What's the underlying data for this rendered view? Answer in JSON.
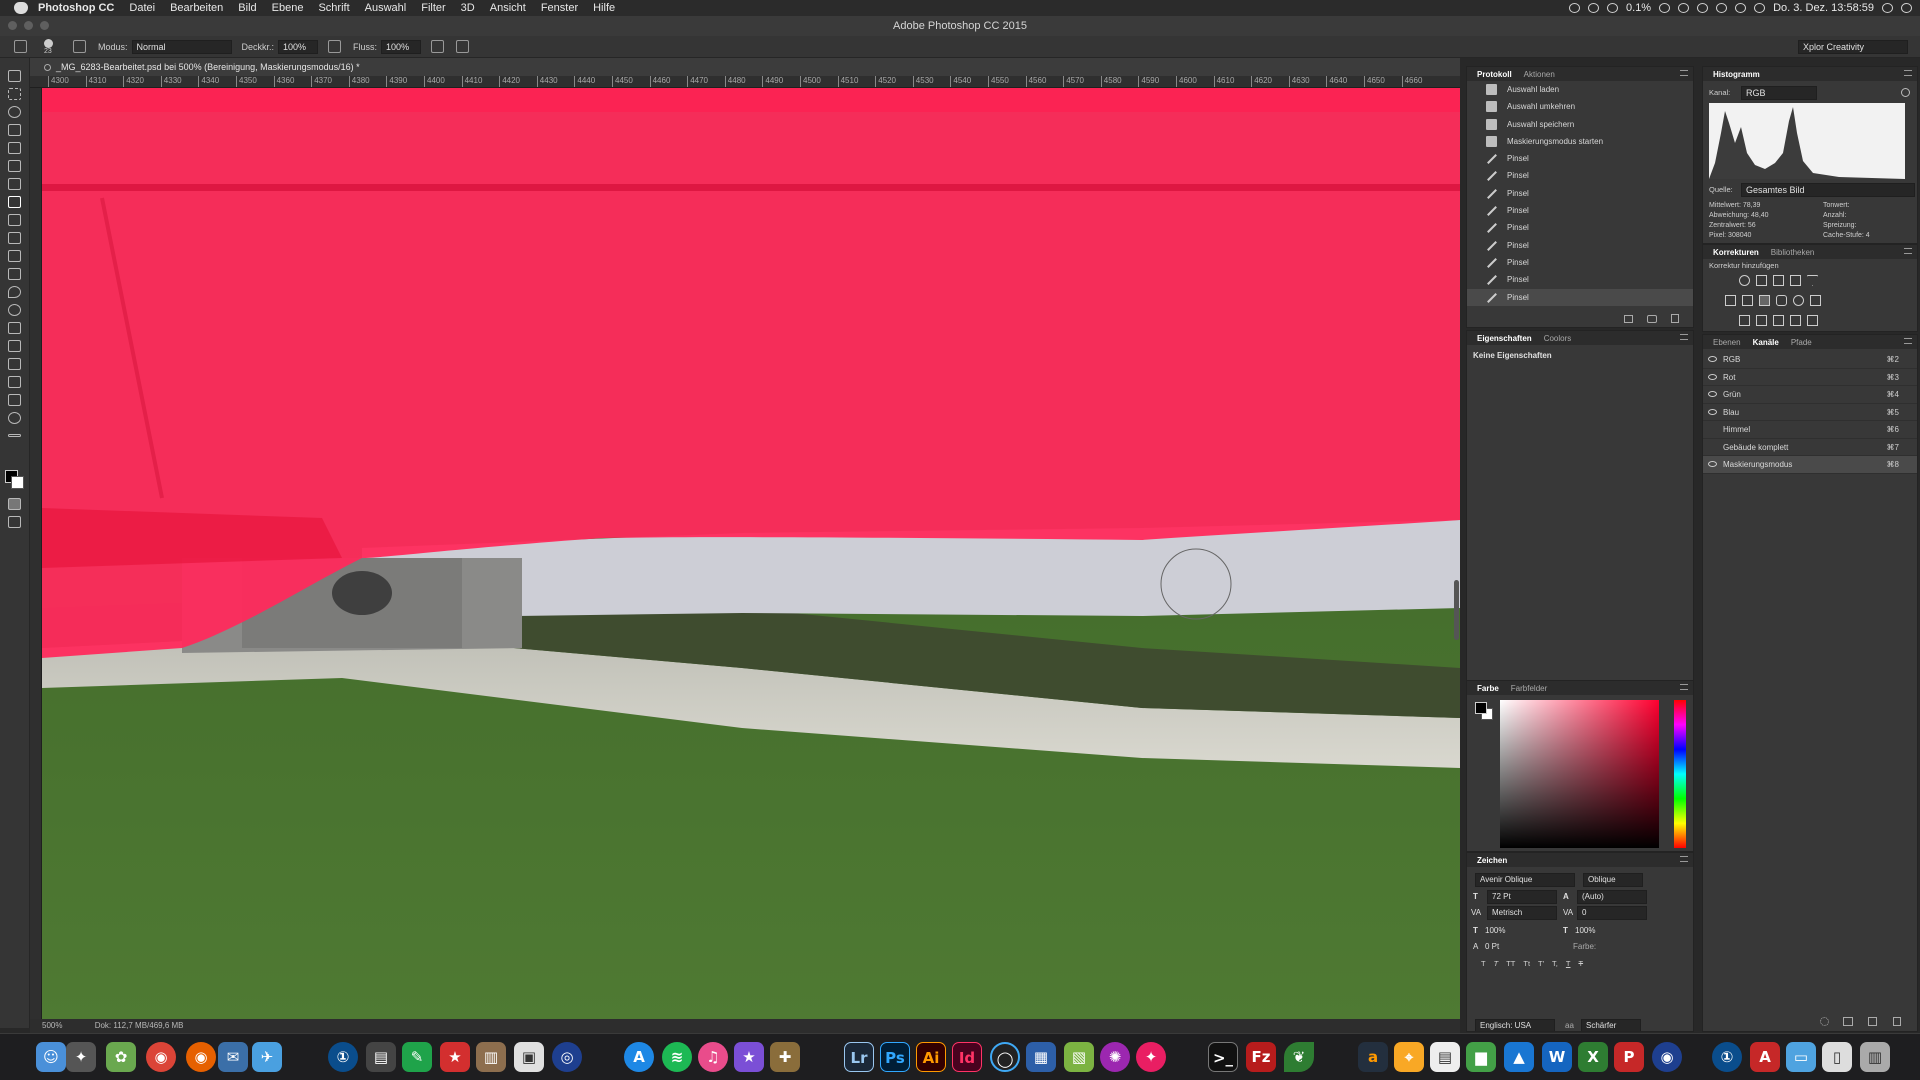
{
  "menubar": {
    "app": "Photoshop CC",
    "items": [
      "Datei",
      "Bearbeiten",
      "Bild",
      "Ebene",
      "Schrift",
      "Auswahl",
      "Filter",
      "3D",
      "Ansicht",
      "Fenster",
      "Hilfe"
    ],
    "battery": "0.1%",
    "datetime": "Do. 3. Dez.  13:58:59"
  },
  "window": {
    "title": "Adobe Photoshop CC 2015"
  },
  "options": {
    "size": "23",
    "mode_label": "Modus:",
    "mode_value": "Normal",
    "opacity_label": "Deckkr.:",
    "opacity_value": "100%",
    "flow_label": "Fluss:",
    "flow_value": "100%",
    "workspace": "Xplor Creativity"
  },
  "document": {
    "tab": "_MG_6283-Bearbeitet.psd bei 500% (Bereinigung, Maskierungsmodus/16) *",
    "ruler_labels": [
      "4300",
      "4310",
      "4320",
      "4330",
      "4340",
      "4350",
      "4360",
      "4370",
      "4380",
      "4390",
      "4400",
      "4410",
      "4420",
      "4430",
      "4440",
      "4450",
      "4460",
      "4470",
      "4480",
      "4490",
      "4500",
      "4510",
      "4520",
      "4530",
      "4540",
      "4550",
      "4560",
      "4570",
      "4580",
      "4590",
      "4600",
      "4610",
      "4620",
      "4630",
      "4640",
      "4650",
      "4660"
    ],
    "zoom": "500%",
    "doc_info": "Dok: 112,7 MB/469,6 MB"
  },
  "history": {
    "tabs": [
      "Protokoll",
      "Aktionen"
    ],
    "items": [
      {
        "label": "Auswahl laden",
        "icon": "document-icon"
      },
      {
        "label": "Auswahl umkehren",
        "icon": "document-icon"
      },
      {
        "label": "Auswahl speichern",
        "icon": "document-icon"
      },
      {
        "label": "Maskierungsmodus starten",
        "icon": "document-icon"
      },
      {
        "label": "Pinsel",
        "icon": "brush-icon"
      },
      {
        "label": "Pinsel",
        "icon": "brush-icon"
      },
      {
        "label": "Pinsel",
        "icon": "brush-icon"
      },
      {
        "label": "Pinsel",
        "icon": "brush-icon"
      },
      {
        "label": "Pinsel",
        "icon": "brush-icon"
      },
      {
        "label": "Pinsel",
        "icon": "brush-icon"
      },
      {
        "label": "Pinsel",
        "icon": "brush-icon"
      },
      {
        "label": "Pinsel",
        "icon": "brush-icon"
      },
      {
        "label": "Pinsel",
        "icon": "brush-icon"
      }
    ]
  },
  "properties": {
    "tabs": [
      "Eigenschaften",
      "Coolors"
    ],
    "text": "Keine Eigenschaften"
  },
  "color": {
    "tabs": [
      "Farbe",
      "Farbfelder"
    ],
    "hue": "#ff0030"
  },
  "character": {
    "title": "Zeichen",
    "font": "Avenir Oblique",
    "style": "Oblique",
    "size": "72 Pt",
    "leading": "(Auto)",
    "kerning": "Metrisch",
    "tracking": "0",
    "vscale": "100%",
    "hscale": "100%",
    "baseline": "0 Pt",
    "color_label": "Farbe:",
    "language": "Englisch: USA",
    "aa_label": "aa",
    "antialias": "Schärfer"
  },
  "histogram": {
    "title": "Histogramm",
    "channel_label": "Kanal:",
    "channel": "RGB",
    "source_label": "Quelle:",
    "source": "Gesamtes Bild",
    "stats_left": [
      "Mittelwert: 78,39",
      "Abweichung: 48,40",
      "Zentralwert: 56",
      "Pixel: 308040"
    ],
    "stats_right": [
      "Tonwert:",
      "Anzahl:",
      "Spreizung:",
      "Cache-Stufe: 4"
    ]
  },
  "adjustments": {
    "tabs": [
      "Korrekturen",
      "Bibliotheken"
    ],
    "subtitle": "Korrektur hinzufügen"
  },
  "channels": {
    "tabs": [
      "Ebenen",
      "Kanäle",
      "Pfade"
    ],
    "items": [
      {
        "name": "RGB",
        "shortcut": "⌘2",
        "visible": true
      },
      {
        "name": "Rot",
        "shortcut": "⌘3",
        "visible": true
      },
      {
        "name": "Grün",
        "shortcut": "⌘4",
        "visible": true
      },
      {
        "name": "Blau",
        "shortcut": "⌘5",
        "visible": true
      },
      {
        "name": "Himmel",
        "shortcut": "⌘6",
        "visible": false
      },
      {
        "name": "Gebäude komplett",
        "shortcut": "⌘7",
        "visible": false
      },
      {
        "name": "Maskierungsmodus",
        "shortcut": "⌘8",
        "visible": true
      }
    ]
  },
  "dock": {
    "labels": [
      "Lr",
      "Ps",
      "Ai",
      "Id",
      "Fz",
      "W",
      "X",
      "P"
    ]
  },
  "colors": {
    "mask": "#ff2a5c",
    "panel_bg": "#383838"
  }
}
